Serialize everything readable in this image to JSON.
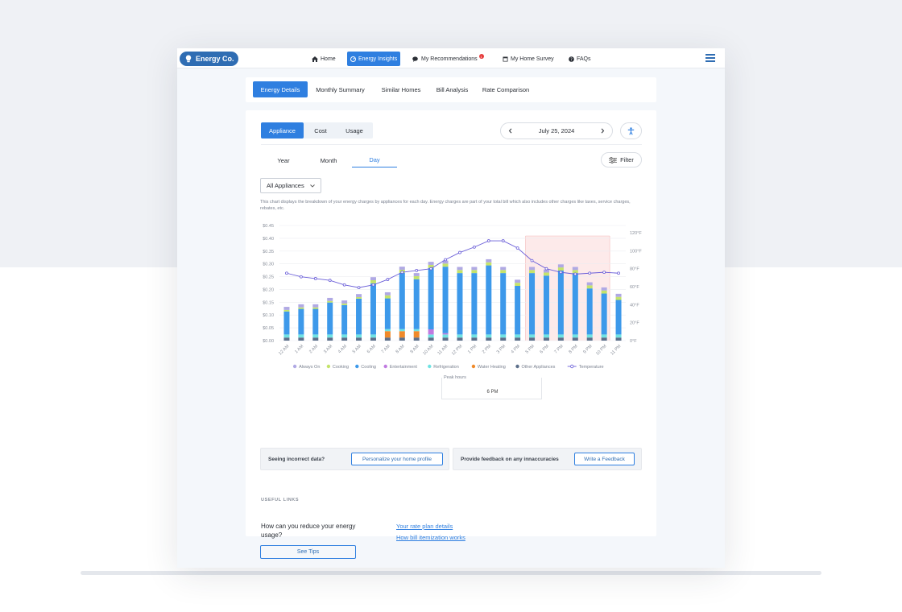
{
  "nav": {
    "brand": "Energy Co.",
    "items": [
      {
        "label": "Home"
      },
      {
        "label": "Energy Insights"
      },
      {
        "label": "My Recommendations",
        "badge": "1"
      },
      {
        "label": "My Home Survey"
      },
      {
        "label": "FAQs"
      }
    ]
  },
  "sub_tabs": [
    "Energy Details",
    "Monthly Summary",
    "Similar Homes",
    "Bill Analysis",
    "Rate Comparison"
  ],
  "view_toggle": [
    "Appliance",
    "Cost",
    "Usage"
  ],
  "date_label": "July 25, 2024",
  "period_tabs": [
    "Year",
    "Month",
    "Day"
  ],
  "filter_label": "Filter",
  "appliance_select": "All Appliances",
  "description": "This chart displays the breakdown of your energy charges by appliances for each day. Energy charges are part of your total bill which also includes other charges like taxes, service charges, rebates, etc.",
  "chart_data": {
    "type": "bar",
    "stacked": true,
    "categories": [
      "12 AM",
      "1 AM",
      "2 AM",
      "3 AM",
      "4 AM",
      "5 AM",
      "6 AM",
      "7 AM",
      "8 AM",
      "9 AM",
      "10 AM",
      "11 AM",
      "12 PM",
      "1 PM",
      "2 PM",
      "3 PM",
      "4 PM",
      "5 PM",
      "6 PM",
      "7 PM",
      "8 PM",
      "9 PM",
      "10 PM",
      "11 PM"
    ],
    "y_ticks": [
      "$0.00",
      "$0.05",
      "$0.10",
      "$0.15",
      "$0.20",
      "$0.25",
      "$0.30",
      "$0.35",
      "$0.40",
      "$0.45"
    ],
    "ylim": [
      0,
      0.45
    ],
    "y2_ticks": [
      "0°F",
      "20°F",
      "40°F",
      "60°F",
      "80°F",
      "100°F",
      "120°F"
    ],
    "y2lim": [
      0,
      120
    ],
    "peak_range": [
      "5 PM",
      "10 PM"
    ],
    "grid": true,
    "legend_position": "bottom",
    "series": [
      {
        "name": "Other Appliances",
        "color": "#5c6f8a",
        "values": [
          0.012,
          0.012,
          0.012,
          0.012,
          0.012,
          0.012,
          0.012,
          0.012,
          0.012,
          0.012,
          0.012,
          0.012,
          0.012,
          0.012,
          0.012,
          0.012,
          0.012,
          0.012,
          0.012,
          0.012,
          0.012,
          0.012,
          0.012,
          0.012
        ]
      },
      {
        "name": "Water Heating",
        "color": "#f08a2a",
        "values": [
          0,
          0,
          0,
          0,
          0,
          0,
          0,
          0.025,
          0.025,
          0.025,
          0,
          0,
          0,
          0,
          0,
          0,
          0,
          0,
          0,
          0,
          0,
          0,
          0,
          0
        ]
      },
      {
        "name": "Refrigeration",
        "color": "#6fe3e3",
        "values": [
          0.012,
          0.012,
          0.012,
          0.012,
          0.012,
          0.012,
          0.012,
          0.008,
          0.008,
          0.008,
          0.012,
          0.012,
          0.012,
          0.012,
          0.012,
          0.012,
          0.012,
          0.012,
          0.012,
          0.012,
          0.012,
          0.012,
          0.012,
          0.012
        ]
      },
      {
        "name": "Entertainment",
        "color": "#c07ae0",
        "values": [
          0,
          0,
          0,
          0,
          0,
          0,
          0,
          0,
          0,
          0,
          0.02,
          0.005,
          0,
          0,
          0,
          0,
          0,
          0,
          0,
          0,
          0,
          0,
          0,
          0
        ]
      },
      {
        "name": "Cooling",
        "color": "#3d99ea",
        "values": [
          0.09,
          0.1,
          0.1,
          0.125,
          0.115,
          0.14,
          0.2,
          0.12,
          0.22,
          0.195,
          0.24,
          0.26,
          0.24,
          0.24,
          0.27,
          0.24,
          0.19,
          0.24,
          0.23,
          0.25,
          0.24,
          0.18,
          0.16,
          0.135
        ]
      },
      {
        "name": "Cooking",
        "color": "#c4e36a",
        "values": [
          0.006,
          0.006,
          0.006,
          0.006,
          0.006,
          0.006,
          0.012,
          0.012,
          0.012,
          0.012,
          0.012,
          0.012,
          0.012,
          0.012,
          0.012,
          0.012,
          0.012,
          0.012,
          0.012,
          0.012,
          0.012,
          0.012,
          0.012,
          0.012
        ]
      },
      {
        "name": "Always On",
        "color": "#b0a9e4",
        "values": [
          0.012,
          0.012,
          0.012,
          0.012,
          0.012,
          0.012,
          0.012,
          0.012,
          0.012,
          0.012,
          0.012,
          0.012,
          0.012,
          0.012,
          0.012,
          0.012,
          0.012,
          0.012,
          0.012,
          0.012,
          0.012,
          0.012,
          0.012,
          0.012
        ]
      }
    ],
    "line_series": {
      "name": "Temperature",
      "color": "#6a5ed8",
      "values": [
        75,
        71,
        69,
        67,
        62,
        59,
        62,
        68,
        76,
        78,
        80,
        90,
        98,
        104,
        111,
        111,
        103,
        89,
        80,
        76,
        74,
        75,
        76,
        75
      ]
    },
    "legend": [
      "Always On",
      "Cooking",
      "Cooling",
      "Entertainment",
      "Refrigeration",
      "Water Heating",
      "Other Appliances",
      "Temperature"
    ]
  },
  "tooltip": {
    "title": "Peak hours",
    "value": "6 PM"
  },
  "feedback": {
    "left_text": "Seeing incorrect data?",
    "left_button": "Personalize your home profile",
    "right_text": "Provide feedback on any innaccuracies",
    "right_button": "Write a Feedback"
  },
  "useful_links": {
    "heading": "USEFUL LINKS",
    "question": "How can you reduce your energy usage?",
    "tips_button": "See Tips",
    "links": [
      "Your rate plan details",
      "How bill itemization works"
    ]
  }
}
